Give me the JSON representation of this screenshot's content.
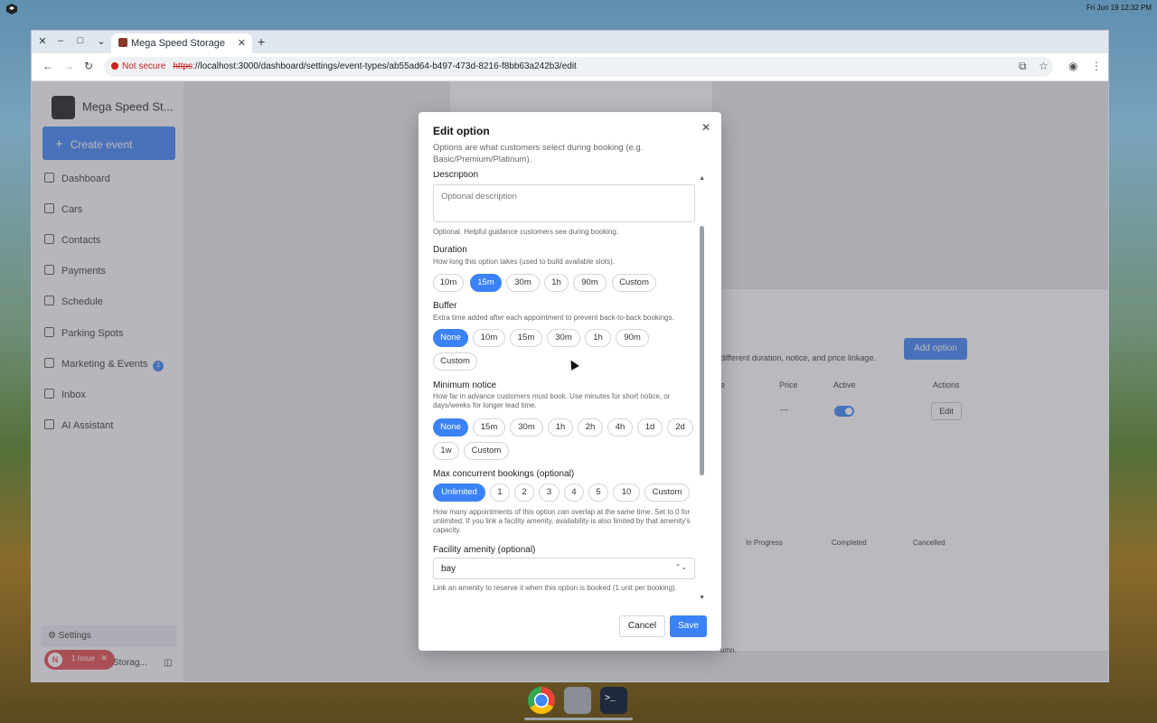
{
  "system": {
    "clock": "Fri Jun 19  12:32 PM"
  },
  "browser": {
    "tab_title": "Mega Speed Storage",
    "security_label": "Not secure",
    "url_scheme": "https",
    "url_rest": "://localhost:3000/dashboard/settings/event-types/ab55ad64-b497-473d-8216-f8bb63a242b3/edit"
  },
  "sidebar": {
    "brand": "Mega Speed St...",
    "create_label": "Create event",
    "items": [
      {
        "label": "Dashboard",
        "icon": "grid-icon"
      },
      {
        "label": "Cars",
        "icon": "car-icon"
      },
      {
        "label": "Contacts",
        "icon": "users-icon"
      },
      {
        "label": "Payments",
        "icon": "card-icon"
      },
      {
        "label": "Schedule",
        "icon": "calendar-icon"
      },
      {
        "label": "Parking Spots",
        "icon": "pin-icon"
      },
      {
        "label": "Marketing & Events",
        "icon": "megaphone-icon",
        "badge": "1"
      },
      {
        "label": "Inbox",
        "icon": "chat-icon"
      },
      {
        "label": "AI Assistant",
        "icon": "sparkle-icon"
      }
    ],
    "settings_label": "Settings",
    "issue_label": "1 Issue",
    "issue_letter": "N",
    "footer_text": "Storag..."
  },
  "background": {
    "add_option": "Add option",
    "hint": "different duration, notice, and price linkage.",
    "col_price": "Price",
    "col_active": "Active",
    "col_actions": "Actions",
    "col_e": "e",
    "price_value": "—",
    "edit": "Edit",
    "status_in_progress": "In Progress",
    "status_completed": "Completed",
    "status_cancelled": "Cancelled",
    "frag_umn": "umn."
  },
  "modal": {
    "title": "Edit option",
    "subtitle": "Options are what customers select during booking (e.g. Basic/Premium/Platinum).",
    "description_label": "Description",
    "description_placeholder": "Optional description",
    "description_help": "Optional. Helpful guidance customers see during booking.",
    "duration_label": "Duration",
    "duration_help": "How long this option takes (used to build available slots).",
    "duration_options": [
      "10m",
      "15m",
      "30m",
      "1h",
      "90m",
      "Custom"
    ],
    "duration_selected": "15m",
    "buffer_label": "Buffer",
    "buffer_help": "Extra time added after each appointment to prevent back-to-back bookings.",
    "buffer_options": [
      "None",
      "10m",
      "15m",
      "30m",
      "1h",
      "90m",
      "Custom"
    ],
    "buffer_selected": "None",
    "notice_label": "Minimum notice",
    "notice_help": "How far in advance customers must book. Use minutes for short notice, or days/weeks for longer lead time.",
    "notice_options": [
      "None",
      "15m",
      "30m",
      "1h",
      "2h",
      "4h",
      "1d",
      "2d",
      "1w",
      "Custom"
    ],
    "notice_selected": "None",
    "concurrent_label": "Max concurrent bookings (optional)",
    "concurrent_options": [
      "Unlimited",
      "1",
      "2",
      "3",
      "4",
      "5",
      "10",
      "Custom"
    ],
    "concurrent_selected": "Unlimited",
    "concurrent_help": "How many appointments of this option can overlap at the same time. Set to 0 for unlimited. If you link a facility amenity, availability is also limited by that amenity's capacity.",
    "amenity_label": "Facility amenity (optional)",
    "amenity_value": "bay",
    "amenity_help": "Link an amenity to reserve it when this option is booked (1 unit per booking).",
    "cancel_label": "Cancel",
    "save_label": "Save"
  }
}
